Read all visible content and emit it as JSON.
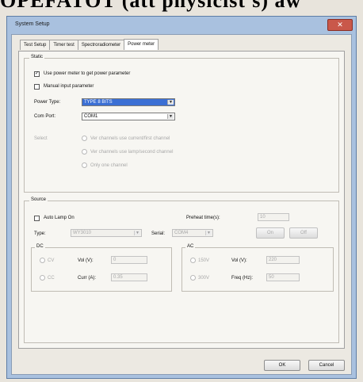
{
  "caption": "OPEFATOT (att physicist's) aw",
  "window": {
    "title": "System Setup",
    "close_glyph": "✕"
  },
  "tabs": [
    {
      "label": "Test Setup",
      "active": false
    },
    {
      "label": "Timer test",
      "active": false
    },
    {
      "label": "Spectroradiometer",
      "active": false
    },
    {
      "label": "Power meter",
      "active": true
    }
  ],
  "static": {
    "legend": "Static",
    "use_power_meter": {
      "label": "Use power meter to get power parameter",
      "checked": true
    },
    "manual_input": {
      "label": "Manual input parameter",
      "checked": false
    },
    "power_type": {
      "label": "Power Type:",
      "value": "TYPE 8 BITS"
    },
    "com_port": {
      "label": "Com Port:",
      "value": "COM1"
    },
    "select": {
      "label": "Select",
      "options": [
        "Ver channels use current/first channel",
        "Ver channels use lamp/second channel",
        "Only one channel"
      ]
    }
  },
  "source": {
    "legend": "Source",
    "auto_lamp": {
      "label": "Auto Lamp On",
      "checked": false
    },
    "preheat": {
      "label": "Preheat time(s):",
      "value": "10"
    },
    "type": {
      "label": "Type:",
      "value": "WY3010"
    },
    "serial": {
      "label": "Serial:",
      "value": "COM4"
    },
    "on_label": "On",
    "off_label": "Off",
    "dc": {
      "legend": "DC",
      "radio1": "CV",
      "radio2": "CC",
      "vol_label": "Vol (V):",
      "vol_value": "0",
      "curr_label": "Curr (A):",
      "curr_value": "0.35"
    },
    "ac": {
      "legend": "AC",
      "radio1": "150V",
      "radio2": "300V",
      "vol_label": "Vol (V):",
      "vol_value": "220",
      "freq_label": "Freq (Hz):",
      "freq_value": "50"
    }
  },
  "buttons": {
    "ok": "OK",
    "cancel": "Cancel"
  }
}
